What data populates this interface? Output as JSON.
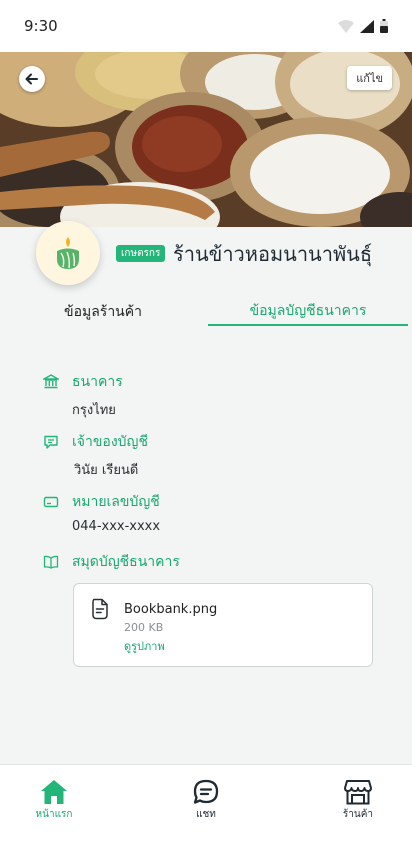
{
  "status_bar": {
    "time": "9:30"
  },
  "header": {
    "edit_label": "แก้ไข"
  },
  "shop": {
    "badge": "เกษตรกร",
    "name": "ร้านข้าวหอมนานาพันธุ์"
  },
  "tabs": [
    {
      "label": "ข้อมูลร้านค้า",
      "active": false
    },
    {
      "label": "ข้อมูลบัญชีธนาคาร",
      "active": true
    }
  ],
  "bank_info": {
    "bank": {
      "title": "ธนาคาร",
      "value": "กรุงไทย"
    },
    "owner": {
      "title": "เจ้าของบัญชี",
      "value": "วินัย เรียนดี"
    },
    "account": {
      "title": "หมายเลขบัญชี",
      "value": "044-xxx-xxxx"
    },
    "passbook": {
      "title": "สมุดบัญชีธนาคาร"
    }
  },
  "file": {
    "name": "Bookbank.png",
    "size": "200 KB",
    "action": "ดูรูปภาพ"
  },
  "bottom_nav": [
    {
      "label": "หน้าแรก",
      "icon": "home-icon",
      "active": true
    },
    {
      "label": "แชท",
      "icon": "chat-icon",
      "active": false
    },
    {
      "label": "ร้านค้า",
      "icon": "store-icon",
      "active": false
    }
  ],
  "colors": {
    "accent": "#24b57a",
    "text": "#1f2a33",
    "background": "#f3f5f4"
  }
}
